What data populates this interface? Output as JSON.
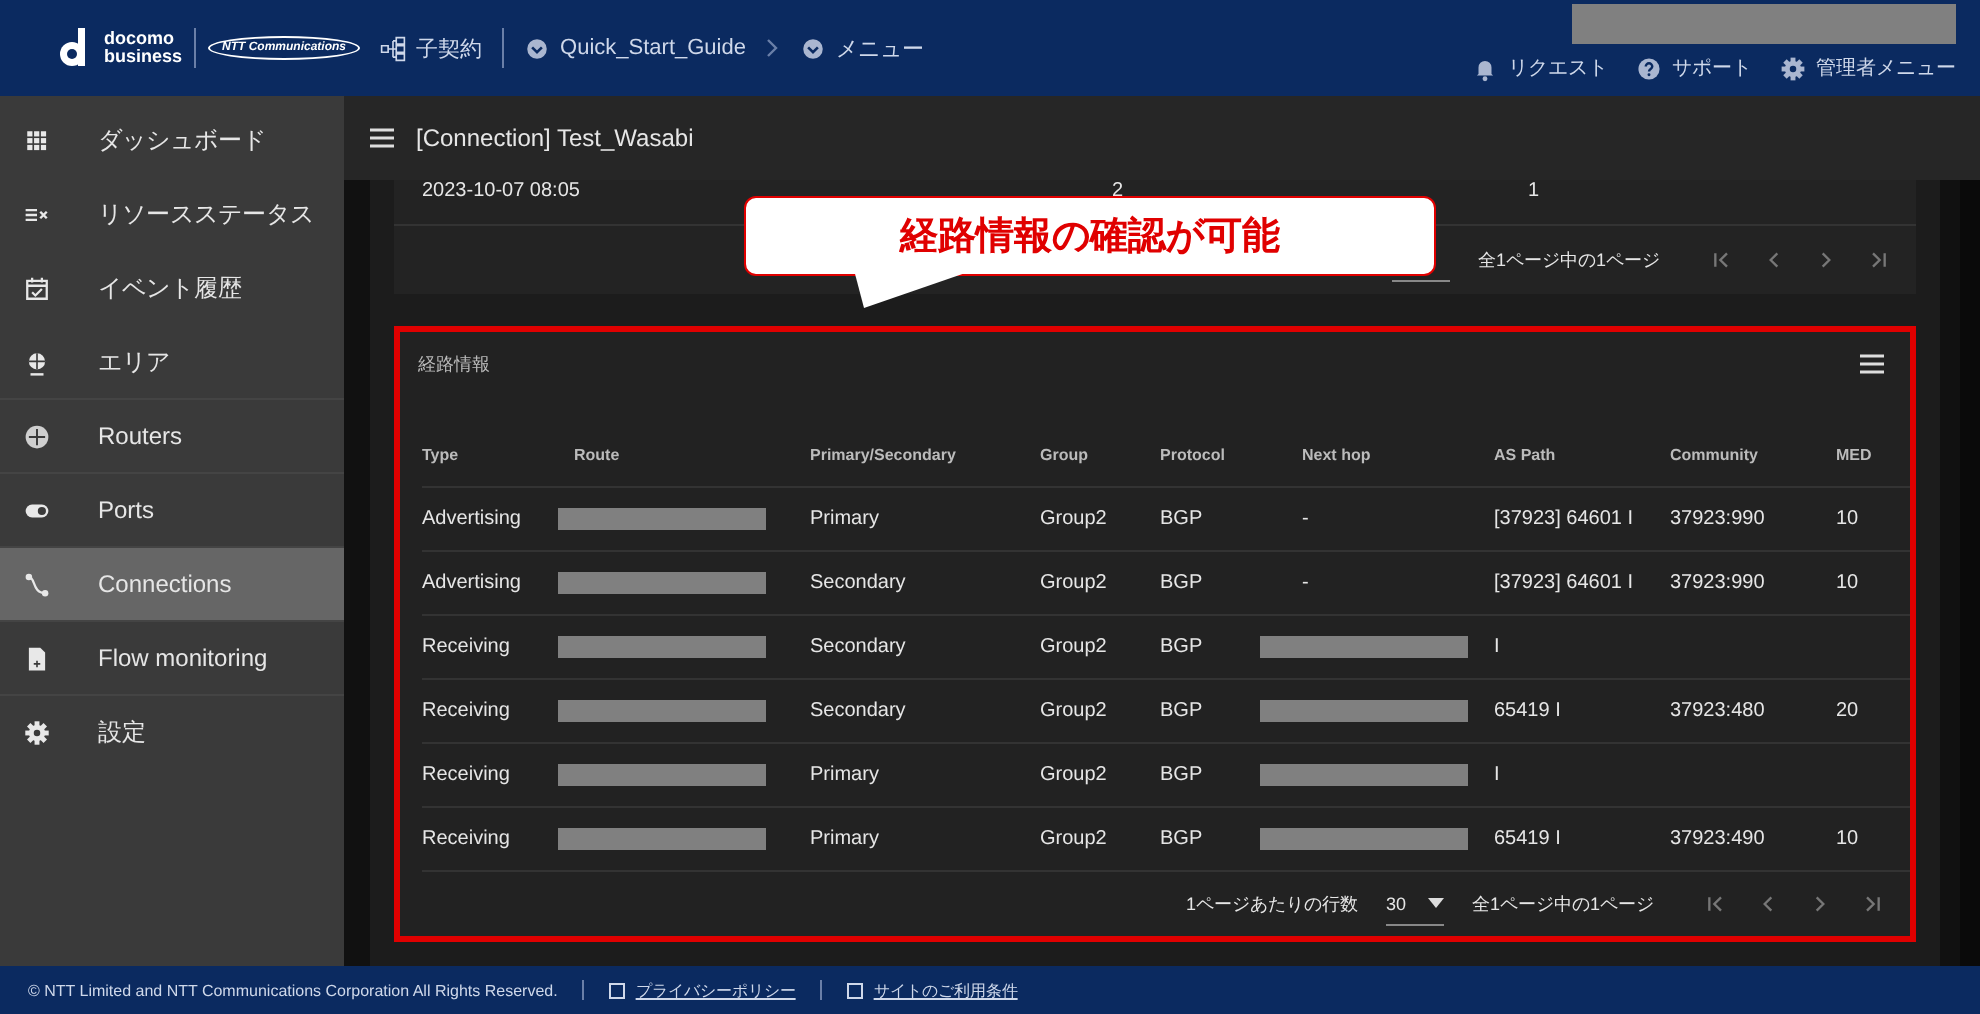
{
  "header": {
    "logo": {
      "line1": "docomo",
      "line2": "business",
      "partner": "NTT Communications"
    },
    "breadcrumbs": [
      {
        "kind": "tree",
        "label": "子契約"
      },
      {
        "kind": "circle",
        "label": "Quick_Start_Guide"
      },
      {
        "kind": "circle",
        "label": "メニュー"
      }
    ],
    "actions": [
      {
        "kind": "bell",
        "label": "リクエスト"
      },
      {
        "kind": "help",
        "label": "サポート"
      },
      {
        "kind": "gear",
        "label": "管理者メニュー"
      }
    ]
  },
  "sidebar": {
    "items": [
      {
        "label": "ダッシュボード",
        "selected": false
      },
      {
        "label": "リソースステータス",
        "selected": false
      },
      {
        "label": "イベント履歴",
        "selected": false
      },
      {
        "label": "エリア",
        "selected": false
      },
      {
        "label": "Routers",
        "selected": false
      },
      {
        "label": "Ports",
        "selected": false
      },
      {
        "label": "Connections",
        "selected": true
      },
      {
        "label": "Flow monitoring",
        "selected": false
      },
      {
        "label": "設定",
        "selected": false
      }
    ]
  },
  "page_title": "[Connection] Test_Wasabi",
  "top_table": {
    "rows": [
      [
        "2023-10-07 08:05",
        "2",
        "1"
      ]
    ],
    "page_info": "全1ページ中の1ページ"
  },
  "callout": {
    "text": "経路情報の確認が可能"
  },
  "route_table": {
    "title": "経路情報",
    "columns": [
      "Type",
      "Route",
      "Primary/Secondary",
      "Group",
      "Protocol",
      "Next hop",
      "AS Path",
      "Community",
      "MED"
    ],
    "rows": [
      {
        "type": "Advertising",
        "route": null,
        "role": "Primary",
        "group": "Group2",
        "protocol": "BGP",
        "next_hop": "-",
        "as_path": "[37923] 64601 I",
        "community": "37923:990",
        "med": "10"
      },
      {
        "type": "Advertising",
        "route": null,
        "role": "Secondary",
        "group": "Group2",
        "protocol": "BGP",
        "next_hop": "-",
        "as_path": "[37923] 64601 I",
        "community": "37923:990",
        "med": "10"
      },
      {
        "type": "Receiving",
        "route": null,
        "role": "Secondary",
        "group": "Group2",
        "protocol": "BGP",
        "next_hop": null,
        "as_path": "I",
        "community": "",
        "med": ""
      },
      {
        "type": "Receiving",
        "route": null,
        "role": "Secondary",
        "group": "Group2",
        "protocol": "BGP",
        "next_hop": null,
        "as_path": "65419 I",
        "community": "37923:480",
        "med": "20"
      },
      {
        "type": "Receiving",
        "route": null,
        "role": "Primary",
        "group": "Group2",
        "protocol": "BGP",
        "next_hop": null,
        "as_path": "I",
        "community": "",
        "med": ""
      },
      {
        "type": "Receiving",
        "route": null,
        "role": "Primary",
        "group": "Group2",
        "protocol": "BGP",
        "next_hop": null,
        "as_path": "65419 I",
        "community": "37923:490",
        "med": "10"
      }
    ],
    "rows_per_page_label": "1ページあたりの行数",
    "rows_per_page": "30",
    "page_info": "全1ページ中の1ページ"
  },
  "footer": {
    "copyright": "© NTT Limited and NTT Communications Corporation All Rights Reserved.",
    "links": [
      "プライバシーポリシー",
      "サイトのご利用条件"
    ]
  }
}
